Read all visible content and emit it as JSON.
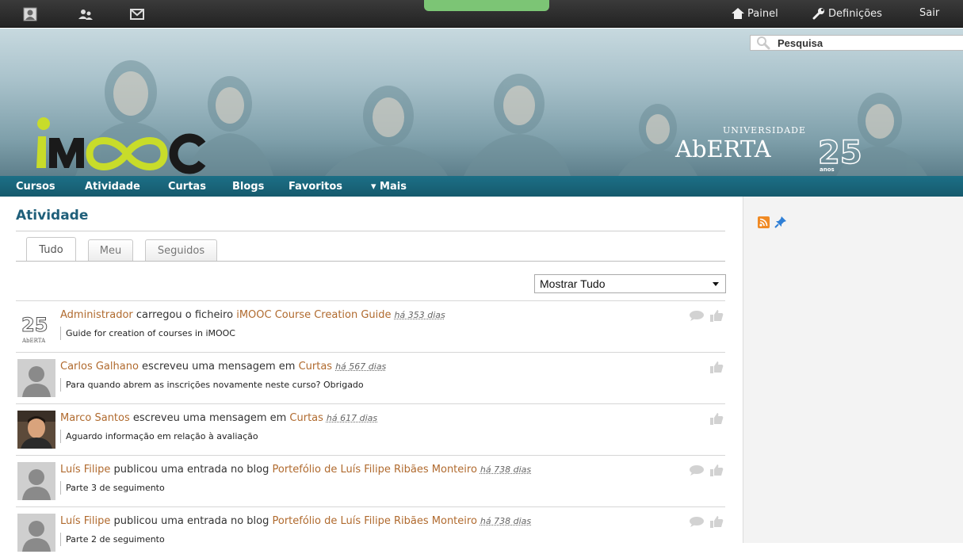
{
  "topbar": {
    "icons": [
      "profile-icon",
      "friends-icon",
      "messages-icon"
    ],
    "dashboard_label": "Painel",
    "settings_label": "Definições",
    "logout_label": "Sair"
  },
  "search": {
    "placeholder": "Pesquisa"
  },
  "banner": {
    "logo_text": "iMOOC",
    "university_small": "UNIVERSIDADE",
    "university_name": "AbERTA",
    "anniversary_number": "25",
    "anniversary_word": "anos"
  },
  "nav": {
    "items": [
      "Cursos",
      "Atividade",
      "Curtas",
      "Blogs",
      "Favoritos",
      "▾ Mais"
    ]
  },
  "page": {
    "title": "Atividade",
    "tabs": [
      "Tudo",
      "Meu",
      "Seguidos"
    ],
    "active_tab": "Tudo",
    "filter": {
      "selected": "Mostrar Tudo"
    }
  },
  "sidebar": {
    "icons": [
      "rss-icon",
      "pin-icon"
    ]
  },
  "feed": [
    {
      "actor": "Administrador",
      "action": " carregou o ficheiro ",
      "object": "iMOOC Course Creation Guide",
      "time": "há 353 dias",
      "description": "Guide for creation of courses in iMOOC",
      "avatar": "aberta-logo",
      "actions": [
        "comment",
        "like"
      ]
    },
    {
      "actor": "Carlos Galhano",
      "action": " escreveu uma mensagem em ",
      "object": "Curtas",
      "time": "há 567 dias",
      "description": "Para quando abrem as inscrições novamente neste curso? Obrigado",
      "avatar": "default",
      "actions": [
        "like"
      ]
    },
    {
      "actor": "Marco Santos",
      "action": " escreveu uma mensagem em ",
      "object": "Curtas",
      "time": "há 617 dias",
      "description": "Aguardo informação em relação à avaliação",
      "avatar": "photo",
      "actions": [
        "like"
      ]
    },
    {
      "actor": "Luís Filipe",
      "action": " publicou uma entrada no blog ",
      "object": "Portefólio de Luís Filipe Ribães Monteiro",
      "time": "há 738 dias",
      "description": "Parte 3 de seguimento",
      "avatar": "default",
      "actions": [
        "comment",
        "like"
      ]
    },
    {
      "actor": "Luís Filipe",
      "action": " publicou uma entrada no blog ",
      "object": "Portefólio de Luís Filipe Ribães Monteiro",
      "time": "há 738 dias",
      "description": "Parte 2 de seguimento",
      "avatar": "default",
      "actions": [
        "comment",
        "like"
      ]
    }
  ],
  "colors": {
    "nav_bg": "#1c6f86",
    "link": "#b06a2e",
    "title": "#1f5f7a",
    "logo_green": "#c8dc2a"
  }
}
